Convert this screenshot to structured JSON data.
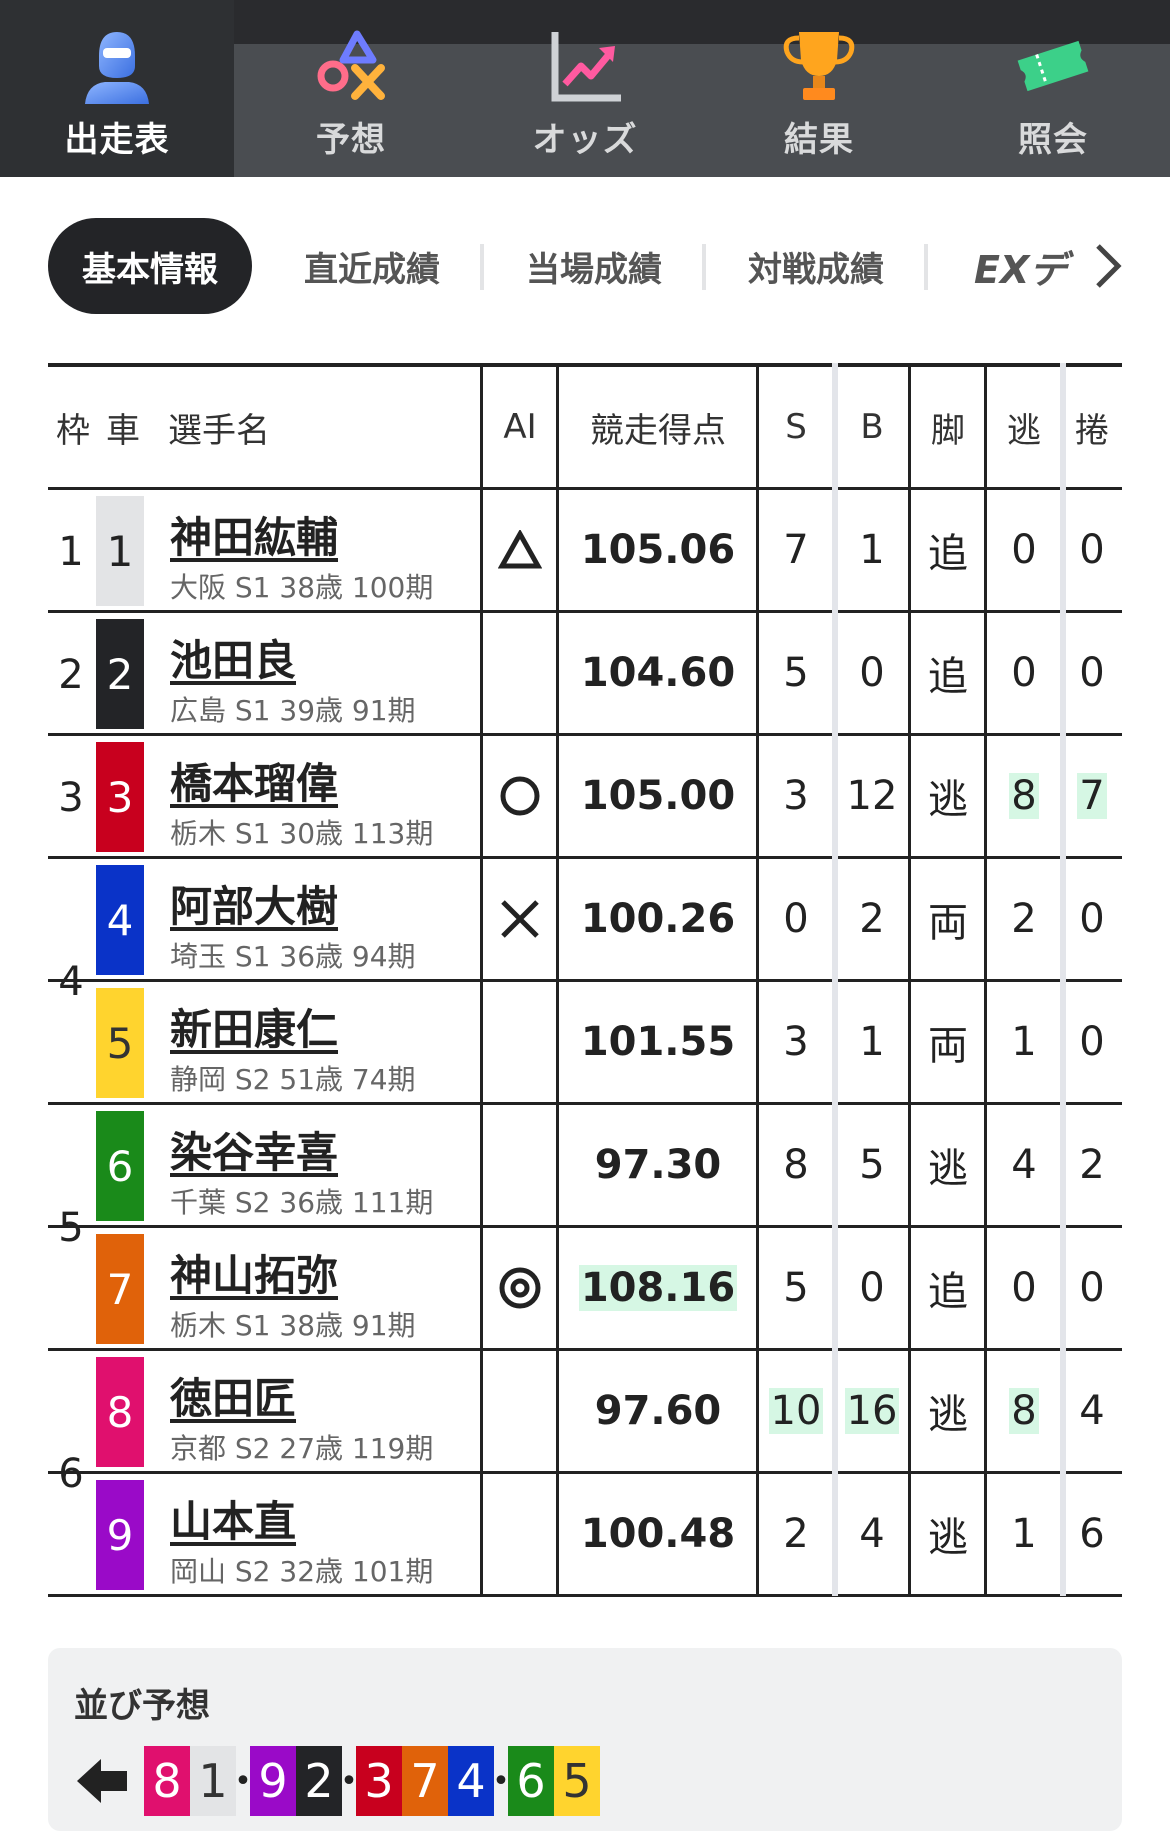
{
  "nav": {
    "items": [
      {
        "label": "出走表",
        "icon": "person-icon",
        "active": true
      },
      {
        "label": "予想",
        "icon": "symbols-icon",
        "active": false
      },
      {
        "label": "オッズ",
        "icon": "chart-icon",
        "active": false
      },
      {
        "label": "結果",
        "icon": "trophy-icon",
        "active": false
      },
      {
        "label": "照会",
        "icon": "ticket-icon",
        "active": false
      }
    ]
  },
  "subtabs": {
    "active": "基本情報",
    "items": [
      "直近成績",
      "当場成績",
      "対戦成績"
    ],
    "more": "EXデ"
  },
  "table": {
    "headers": {
      "waku": "枠",
      "car": "車",
      "name": "選手名",
      "ai": "AI",
      "score": "競走得点",
      "s": "S",
      "b": "B",
      "leg": "脚",
      "nige": "逃",
      "makuri": "捲"
    },
    "wakus": [
      {
        "label": "1"
      },
      {
        "label": "2"
      },
      {
        "label": "3"
      },
      {
        "label": "4"
      },
      {
        "label": "5"
      },
      {
        "label": "6"
      }
    ],
    "rows": [
      {
        "car": "1",
        "name": "神田紘輔",
        "sub": "大阪 S1 38歳 100期",
        "ai": "△",
        "score": "105.06",
        "s": "7",
        "b": "1",
        "leg": "追",
        "nige": "0",
        "makuri": "0"
      },
      {
        "car": "2",
        "name": "池田良",
        "sub": "広島 S1 39歳 91期",
        "ai": "",
        "score": "104.60",
        "s": "5",
        "b": "0",
        "leg": "追",
        "nige": "0",
        "makuri": "0"
      },
      {
        "car": "3",
        "name": "橋本瑠偉",
        "sub": "栃木 S1 30歳 113期",
        "ai": "○",
        "score": "105.00",
        "s": "3",
        "b": "12",
        "leg": "逃",
        "nige": "8",
        "makuri": "7"
      },
      {
        "car": "4",
        "name": "阿部大樹",
        "sub": "埼玉 S1 36歳 94期",
        "ai": "✕",
        "score": "100.26",
        "s": "0",
        "b": "2",
        "leg": "両",
        "nige": "2",
        "makuri": "0"
      },
      {
        "car": "5",
        "name": "新田康仁",
        "sub": "静岡 S2 51歳 74期",
        "ai": "",
        "score": "101.55",
        "s": "3",
        "b": "1",
        "leg": "両",
        "nige": "1",
        "makuri": "0"
      },
      {
        "car": "6",
        "name": "染谷幸喜",
        "sub": "千葉 S2 36歳 111期",
        "ai": "",
        "score": "97.30",
        "s": "8",
        "b": "5",
        "leg": "逃",
        "nige": "4",
        "makuri": "2"
      },
      {
        "car": "7",
        "name": "神山拓弥",
        "sub": "栃木 S1 38歳 91期",
        "ai": "◎",
        "score": "108.16",
        "s": "5",
        "b": "0",
        "leg": "追",
        "nige": "0",
        "makuri": "0"
      },
      {
        "car": "8",
        "name": "徳田匠",
        "sub": "京都 S2 27歳 119期",
        "ai": "",
        "score": "97.60",
        "s": "10",
        "b": "16",
        "leg": "逃",
        "nige": "8",
        "makuri": "4"
      },
      {
        "car": "9",
        "name": "山本直",
        "sub": "岡山 S2 32歳 101期",
        "ai": "",
        "score": "100.48",
        "s": "2",
        "b": "4",
        "leg": "逃",
        "nige": "1",
        "makuri": "6"
      }
    ]
  },
  "prediction": {
    "title": "並び予想",
    "sequence": [
      "8",
      "1",
      "9",
      "2",
      "3",
      "7",
      "4",
      "6",
      "5"
    ],
    "dot": "•"
  },
  "colors": {
    "car1": "#e3e4e6",
    "car2": "#232427",
    "car3": "#c8001e",
    "car4": "#0a33c8",
    "car5": "#ffd42e",
    "car6": "#1a8a1a",
    "car7": "#e0620a",
    "car8": "#e0106e",
    "car9": "#9a0ac8",
    "highlight": "#d6f7e4"
  }
}
